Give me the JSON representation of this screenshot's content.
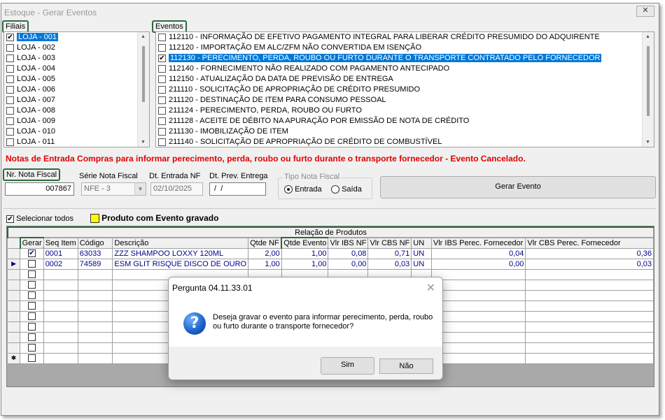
{
  "window": {
    "title": "Estoque - Gerar Eventos",
    "close_glyph": "✕"
  },
  "filiais": {
    "label": "Filiais",
    "items": [
      {
        "label": "LOJA - 001",
        "checked": true,
        "selected": true
      },
      {
        "label": "LOJA - 002",
        "checked": false,
        "selected": false
      },
      {
        "label": "LOJA - 003",
        "checked": false,
        "selected": false
      },
      {
        "label": "LOJA - 004",
        "checked": false,
        "selected": false
      },
      {
        "label": "LOJA - 005",
        "checked": false,
        "selected": false
      },
      {
        "label": "LOJA - 006",
        "checked": false,
        "selected": false
      },
      {
        "label": "LOJA - 007",
        "checked": false,
        "selected": false
      },
      {
        "label": "LOJA - 008",
        "checked": false,
        "selected": false
      },
      {
        "label": "LOJA - 009",
        "checked": false,
        "selected": false
      },
      {
        "label": "LOJA - 010",
        "checked": false,
        "selected": false
      },
      {
        "label": "LOJA - 011",
        "checked": false,
        "selected": false
      }
    ]
  },
  "eventos": {
    "label": "Eventos",
    "items": [
      {
        "label": "112110 - INFORMAÇÃO DE EFETIVO PAGAMENTO INTEGRAL PARA LIBERAR CRÉDITO PRESUMIDO DO ADQUIRENTE",
        "checked": false,
        "selected": false
      },
      {
        "label": "112120 - IMPORTAÇÃO EM ALC/ZFM NÃO CONVERTIDA EM ISENÇÃO",
        "checked": false,
        "selected": false
      },
      {
        "label": "112130 - PERECIMENTO, PERDA, ROUBO OU FURTO DURANTE O TRANSPORTE CONTRATADO PELO FORNECEDOR",
        "checked": true,
        "selected": true
      },
      {
        "label": "112140 - FORNECIMENTO NÃO REALIZADO COM PAGAMENTO ANTECIPADO",
        "checked": false,
        "selected": false
      },
      {
        "label": "112150 - ATUALIZAÇÃO DA DATA DE PREVISÃO DE ENTREGA",
        "checked": false,
        "selected": false
      },
      {
        "label": "211110 - SOLICITAÇÃO DE APROPRIAÇÃO DE CRÉDITO PRESUMIDO",
        "checked": false,
        "selected": false
      },
      {
        "label": "211120 - DESTINAÇÃO DE ITEM PARA CONSUMO PESSOAL",
        "checked": false,
        "selected": false
      },
      {
        "label": "211124 - PERECIMENTO, PERDA, ROUBO OU FURTO",
        "checked": false,
        "selected": false
      },
      {
        "label": "211128 - ACEITE DE DÉBITO NA APURAÇÃO POR EMISSÃO DE NOTA DE CRÉDITO",
        "checked": false,
        "selected": false
      },
      {
        "label": "211130 - IMOBILIZAÇÃO DE ITEM",
        "checked": false,
        "selected": false
      },
      {
        "label": "211140 - SOLICITAÇÃO DE APROPRIAÇÃO DE CRÉDITO DE COMBUSTÍVEL",
        "checked": false,
        "selected": false
      }
    ]
  },
  "warning_text": "Notas de Entrada Compras para informar perecimento, perda, roubo ou furto durante o transporte fornecedor - Evento Cancelado.",
  "form": {
    "nr_nota_label": "Nr. Nota Fiscal",
    "nr_nota_value": "007867",
    "serie_label": "Série Nota Fiscal",
    "serie_value": "NFE - 3",
    "dt_entrada_label": "Dt. Entrada NF",
    "dt_entrada_value": "02/10/2025",
    "dt_prev_label": "Dt. Prev. Entrega",
    "dt_prev_value": " /  /",
    "tipo_label": "Tipo Nota Fiscal",
    "entrada_label": "Entrada",
    "saida_label": "Saída",
    "gerar_evento_label": "Gerar Evento"
  },
  "options": {
    "selecionar_todos_label": "Selecionar todos",
    "legend_label": "Produto com Evento gravado",
    "legend_color": "#ffff00"
  },
  "grid": {
    "caption": "Relação de Produtos",
    "headers": [
      "Gerar",
      "Seq Item",
      "Código",
      "Descrição",
      "Qtde NF",
      "Qtde Evento",
      "Vlr IBS NF",
      "Vlr CBS NF",
      "UN",
      "Vlr IBS Perec. Fornecedor",
      "Vlr CBS Perec. Fornecedor"
    ],
    "rows": [
      {
        "gerar": true,
        "seq": "0001",
        "codigo": "63033",
        "descricao": "ZZZ SHAMPOO LOXXY 120ML",
        "qtde_nf": "2,00",
        "qtde_evento": "1,00",
        "ibs_nf": "0,08",
        "cbs_nf": "0,71",
        "un": "UN",
        "ibs_perec": "0,04",
        "cbs_perec": "0,36"
      },
      {
        "gerar": false,
        "seq": "0002",
        "codigo": "74589",
        "descricao": "ESM GLIT RISQUE DISCO DE OURO",
        "qtde_nf": "1,00",
        "qtde_evento": "1,00",
        "ibs_nf": "0,00",
        "cbs_nf": "0,03",
        "un": "UN",
        "ibs_perec": "0,00",
        "cbs_perec": "0,03"
      }
    ],
    "current_row_marker": "▶",
    "new_row_marker": "✱",
    "data_color": "#00008b"
  },
  "dialog": {
    "title": "Pergunta 04.11.33.01",
    "close_glyph": "✕",
    "icon_glyph": "?",
    "message": "Deseja gravar o evento para informar perecimento, perda, roubo ou furto durante o transporte fornecedor?",
    "yes_label": "Sim",
    "no_label": "Não"
  }
}
